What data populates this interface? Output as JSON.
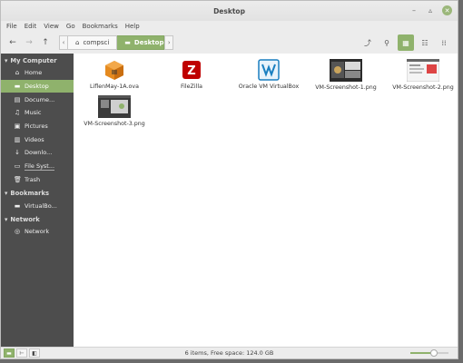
{
  "window": {
    "title": "Desktop"
  },
  "menu": [
    "File",
    "Edit",
    "View",
    "Go",
    "Bookmarks",
    "Help"
  ],
  "breadcrumbs": [
    {
      "label": "compsci",
      "icon": "home-icon"
    },
    {
      "label": "Desktop",
      "icon": "folder-icon"
    }
  ],
  "sidebar": {
    "sections": [
      {
        "title": "My Computer",
        "items": [
          {
            "label": "Home",
            "icon": "home-icon"
          },
          {
            "label": "Desktop",
            "icon": "folder-icon",
            "selected": true
          },
          {
            "label": "Docume...",
            "icon": "document-icon"
          },
          {
            "label": "Music",
            "icon": "music-icon"
          },
          {
            "label": "Pictures",
            "icon": "pictures-icon"
          },
          {
            "label": "Videos",
            "icon": "video-icon"
          },
          {
            "label": "Downlo...",
            "icon": "download-icon"
          },
          {
            "label": "File Syst...",
            "icon": "drive-icon"
          },
          {
            "label": "Trash",
            "icon": "trash-icon"
          }
        ]
      },
      {
        "title": "Bookmarks",
        "items": [
          {
            "label": "VirtualBo...",
            "icon": "folder-icon"
          }
        ]
      },
      {
        "title": "Network",
        "items": [
          {
            "label": "Network",
            "icon": "network-icon"
          }
        ]
      }
    ]
  },
  "files": [
    {
      "name": "LiflenMay-1A.ova",
      "icon": "package-icon"
    },
    {
      "name": "FileZilla",
      "icon": "filezilla-icon"
    },
    {
      "name": "Oracle VM VirtualBox",
      "icon": "virtualbox-icon"
    },
    {
      "name": "VM-Screenshot-1.png",
      "icon": "image-thumbnail-icon"
    },
    {
      "name": "VM-Screenshot-2.png",
      "icon": "image-thumbnail-icon"
    },
    {
      "name": "VM-Screenshot-3.png",
      "icon": "image-thumbnail-icon"
    }
  ],
  "status": {
    "text": "6 items, Free space: 124.0 GB",
    "zoom": 0.62
  },
  "colors": {
    "accent": "#8fb26c",
    "sidebar_bg": "#4d4d4d"
  }
}
